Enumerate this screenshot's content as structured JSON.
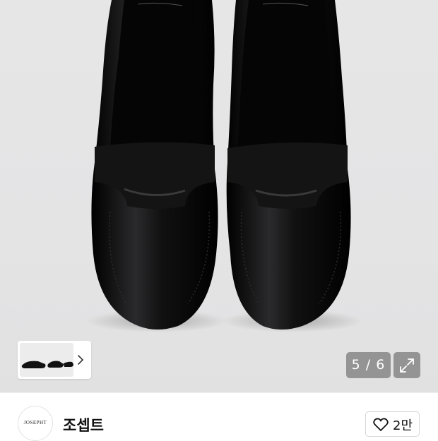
{
  "gallery": {
    "image_alt": "black leather penny loafers",
    "thumbnail_icon": "chevron-right-icon",
    "counter": "5 / 6",
    "expand_icon": "expand-arrows-icon"
  },
  "brand": {
    "logo_text": "JOSEPHT",
    "name": "조셉트",
    "like_icon": "heart-outline-icon",
    "like_count": "2만"
  },
  "colors": {
    "background": "#e4e4e5",
    "shoe": "#0b0b0c",
    "overlay": "#646464"
  }
}
